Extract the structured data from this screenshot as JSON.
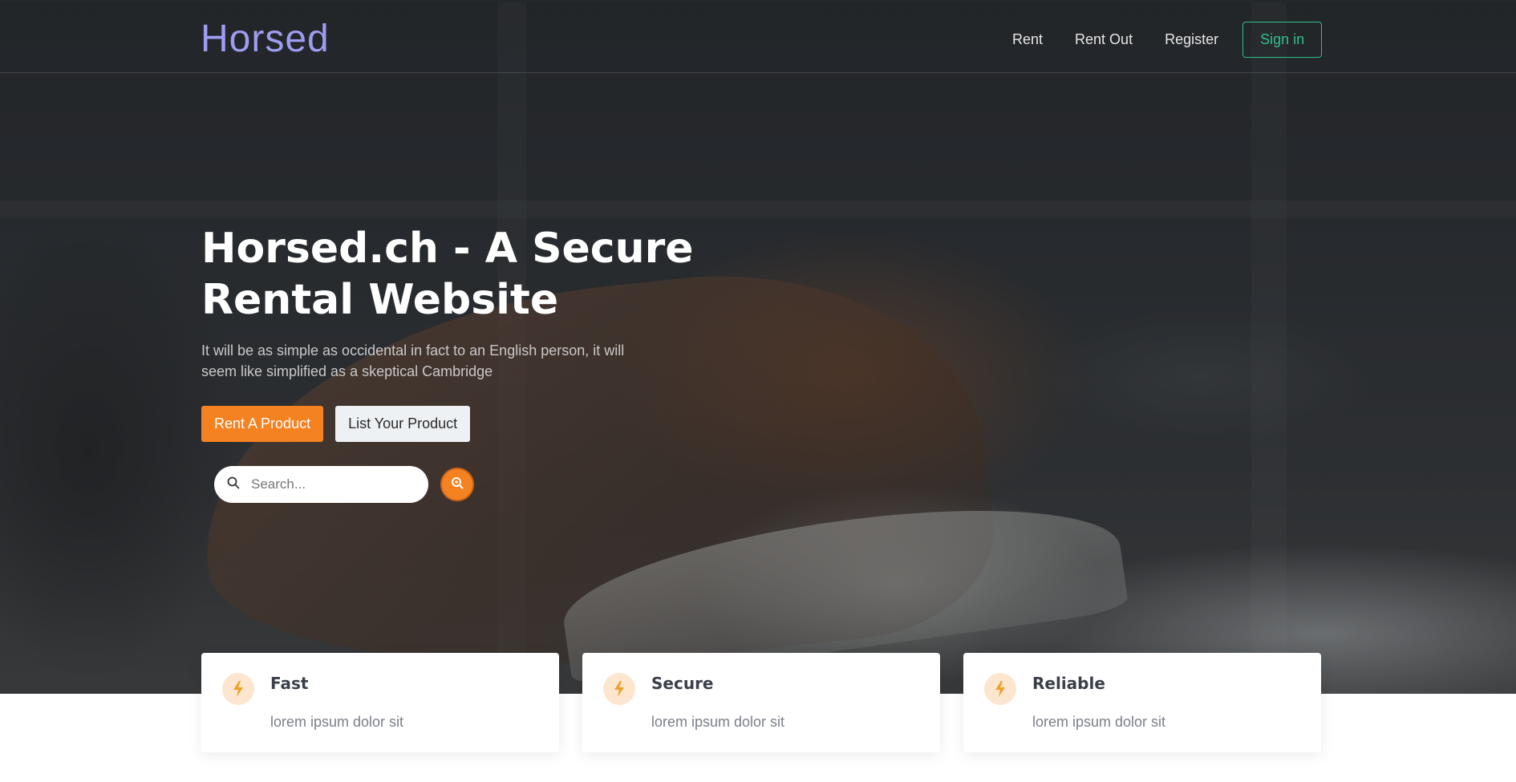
{
  "brand": {
    "logo_text": "Horsed"
  },
  "nav": {
    "links": [
      "Rent",
      "Rent Out",
      "Register"
    ],
    "signin_label": "Sign in"
  },
  "hero": {
    "title": "Horsed.ch - A Secure Rental Website",
    "subtitle": "It will be as simple as occidental in fact to an English person, it will seem like simplified as a skeptical Cambridge",
    "primary_button": "Rent A Product",
    "secondary_button": "List Your Product",
    "search_placeholder": "Search..."
  },
  "features": [
    {
      "title": "Fast",
      "text": "lorem ipsum dolor sit",
      "icon": "bolt-icon"
    },
    {
      "title": "Secure",
      "text": "lorem ipsum dolor sit",
      "icon": "bolt-icon"
    },
    {
      "title": "Reliable",
      "text": "lorem ipsum dolor sit",
      "icon": "bolt-icon"
    }
  ],
  "colors": {
    "accent": "#f58220",
    "signin": "#2fbf8a",
    "logo": "#9d9cf0",
    "icon_bg": "#fde6cf"
  }
}
